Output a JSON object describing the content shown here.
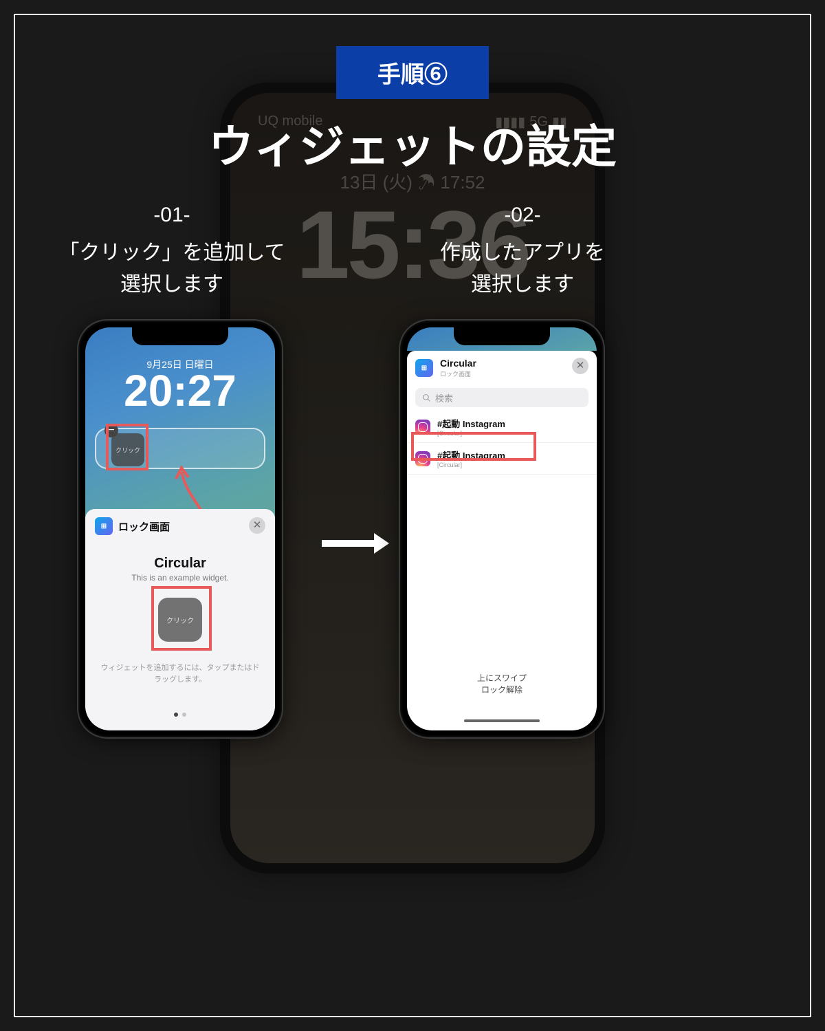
{
  "header": {
    "step_badge": "手順⑥",
    "title": "ウィジェットの設定"
  },
  "bg_phone": {
    "carrier": "UQ mobile",
    "network": "5G",
    "date": "13日 (火) ☂ 17:52",
    "time": "15:36"
  },
  "captions": {
    "left_no": "-01-",
    "left_line1": "「クリック」を追加して",
    "left_line2": "選択します",
    "right_no": "-02-",
    "right_line1": "作成したアプリを",
    "right_line2": "選択します"
  },
  "phone1": {
    "lock_date": "9月25日 日曜日",
    "lock_time": "20:27",
    "widget_click_label": "クリック",
    "remove_symbol": "−",
    "sheet": {
      "header_title": "ロック画面",
      "close_symbol": "✕",
      "h1": "Circular",
      "subtitle": "This is an example widget.",
      "widget_label": "クリック",
      "hint": "ウィジェットを追加するには、タップまたはドラッグします。"
    }
  },
  "phone2": {
    "header_title": "Circular",
    "header_sub": "ロック画面",
    "close_symbol": "✕",
    "search_placeholder": "検索",
    "rows": [
      {
        "title": "#起動 Instagram",
        "sub": "[Circular]"
      },
      {
        "title": "#起動 Instagram",
        "sub": "[Circular]"
      }
    ],
    "swipe_hint_l1": "上にスワイプ",
    "swipe_hint_l2": "ロック解除"
  }
}
